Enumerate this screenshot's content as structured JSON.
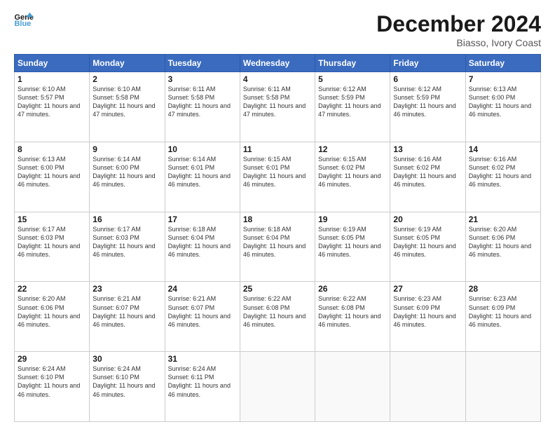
{
  "logo": {
    "line1": "General",
    "line2": "Blue"
  },
  "title": "December 2024",
  "location": "Biasso, Ivory Coast",
  "days_of_week": [
    "Sunday",
    "Monday",
    "Tuesday",
    "Wednesday",
    "Thursday",
    "Friday",
    "Saturday"
  ],
  "weeks": [
    [
      {
        "num": "1",
        "rise": "6:10 AM",
        "set": "5:57 PM",
        "daylight": "11 hours and 47 minutes."
      },
      {
        "num": "2",
        "rise": "6:10 AM",
        "set": "5:58 PM",
        "daylight": "11 hours and 47 minutes."
      },
      {
        "num": "3",
        "rise": "6:11 AM",
        "set": "5:58 PM",
        "daylight": "11 hours and 47 minutes."
      },
      {
        "num": "4",
        "rise": "6:11 AM",
        "set": "5:58 PM",
        "daylight": "11 hours and 47 minutes."
      },
      {
        "num": "5",
        "rise": "6:12 AM",
        "set": "5:59 PM",
        "daylight": "11 hours and 47 minutes."
      },
      {
        "num": "6",
        "rise": "6:12 AM",
        "set": "5:59 PM",
        "daylight": "11 hours and 46 minutes."
      },
      {
        "num": "7",
        "rise": "6:13 AM",
        "set": "6:00 PM",
        "daylight": "11 hours and 46 minutes."
      }
    ],
    [
      {
        "num": "8",
        "rise": "6:13 AM",
        "set": "6:00 PM",
        "daylight": "11 hours and 46 minutes."
      },
      {
        "num": "9",
        "rise": "6:14 AM",
        "set": "6:00 PM",
        "daylight": "11 hours and 46 minutes."
      },
      {
        "num": "10",
        "rise": "6:14 AM",
        "set": "6:01 PM",
        "daylight": "11 hours and 46 minutes."
      },
      {
        "num": "11",
        "rise": "6:15 AM",
        "set": "6:01 PM",
        "daylight": "11 hours and 46 minutes."
      },
      {
        "num": "12",
        "rise": "6:15 AM",
        "set": "6:02 PM",
        "daylight": "11 hours and 46 minutes."
      },
      {
        "num": "13",
        "rise": "6:16 AM",
        "set": "6:02 PM",
        "daylight": "11 hours and 46 minutes."
      },
      {
        "num": "14",
        "rise": "6:16 AM",
        "set": "6:02 PM",
        "daylight": "11 hours and 46 minutes."
      }
    ],
    [
      {
        "num": "15",
        "rise": "6:17 AM",
        "set": "6:03 PM",
        "daylight": "11 hours and 46 minutes."
      },
      {
        "num": "16",
        "rise": "6:17 AM",
        "set": "6:03 PM",
        "daylight": "11 hours and 46 minutes."
      },
      {
        "num": "17",
        "rise": "6:18 AM",
        "set": "6:04 PM",
        "daylight": "11 hours and 46 minutes."
      },
      {
        "num": "18",
        "rise": "6:18 AM",
        "set": "6:04 PM",
        "daylight": "11 hours and 46 minutes."
      },
      {
        "num": "19",
        "rise": "6:19 AM",
        "set": "6:05 PM",
        "daylight": "11 hours and 46 minutes."
      },
      {
        "num": "20",
        "rise": "6:19 AM",
        "set": "6:05 PM",
        "daylight": "11 hours and 46 minutes."
      },
      {
        "num": "21",
        "rise": "6:20 AM",
        "set": "6:06 PM",
        "daylight": "11 hours and 46 minutes."
      }
    ],
    [
      {
        "num": "22",
        "rise": "6:20 AM",
        "set": "6:06 PM",
        "daylight": "11 hours and 46 minutes."
      },
      {
        "num": "23",
        "rise": "6:21 AM",
        "set": "6:07 PM",
        "daylight": "11 hours and 46 minutes."
      },
      {
        "num": "24",
        "rise": "6:21 AM",
        "set": "6:07 PM",
        "daylight": "11 hours and 46 minutes."
      },
      {
        "num": "25",
        "rise": "6:22 AM",
        "set": "6:08 PM",
        "daylight": "11 hours and 46 minutes."
      },
      {
        "num": "26",
        "rise": "6:22 AM",
        "set": "6:08 PM",
        "daylight": "11 hours and 46 minutes."
      },
      {
        "num": "27",
        "rise": "6:23 AM",
        "set": "6:09 PM",
        "daylight": "11 hours and 46 minutes."
      },
      {
        "num": "28",
        "rise": "6:23 AM",
        "set": "6:09 PM",
        "daylight": "11 hours and 46 minutes."
      }
    ],
    [
      {
        "num": "29",
        "rise": "6:24 AM",
        "set": "6:10 PM",
        "daylight": "11 hours and 46 minutes."
      },
      {
        "num": "30",
        "rise": "6:24 AM",
        "set": "6:10 PM",
        "daylight": "11 hours and 46 minutes."
      },
      {
        "num": "31",
        "rise": "6:24 AM",
        "set": "6:11 PM",
        "daylight": "11 hours and 46 minutes."
      },
      null,
      null,
      null,
      null
    ]
  ]
}
